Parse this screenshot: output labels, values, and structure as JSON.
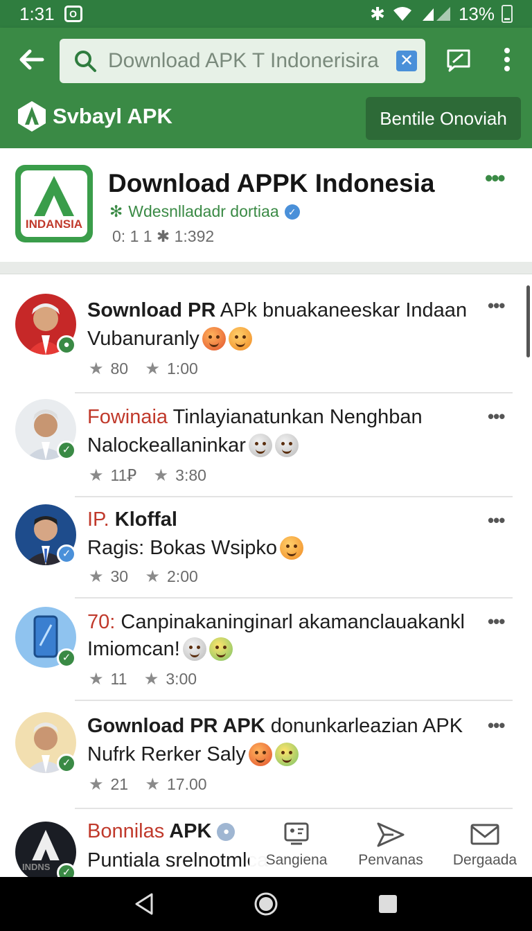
{
  "status_bar": {
    "time": "1:31",
    "battery": "13%",
    "icons": [
      "notification-icon",
      "bluetooth-icon",
      "wifi-icon",
      "signal-icon",
      "battery-icon"
    ]
  },
  "app_bar": {
    "search": {
      "value": "Download APK T Indonerisira",
      "placeholder": "Download APK T Indonerisira"
    },
    "brand_name": "Svbayl APK",
    "action_label": "Bentile Onoviah"
  },
  "app_info": {
    "logo_text": "INDANSIA",
    "title": "Download APPK Indonesia",
    "subtitle": "Wdesnlladadr dortiaa",
    "stats": "0: 1 1  ✱ 1:392"
  },
  "posts": [
    {
      "title_highlight": "",
      "title_bold": "Sownload PR",
      "title_rest": " APk bnuakaneeskar Indaan",
      "line2": "Vubanuranly",
      "emojis": [
        "red",
        "orange"
      ],
      "likes": "80",
      "time": "1:00",
      "badge": "green"
    },
    {
      "title_highlight": "Fowinaia",
      "title_bold": "",
      "title_rest": " Tinlayianatunkan Nenghban",
      "line2": "Nalockeallaninkar",
      "emojis": [
        "grey",
        "grey"
      ],
      "likes": "11Ꝑ",
      "time": "3:80",
      "badge": "green"
    },
    {
      "title_highlight": "IP.",
      "title_bold": " Kloffal",
      "title_rest": "",
      "line2": "Ragis: Bokas Wsipko",
      "emojis": [
        "orange"
      ],
      "likes": "30",
      "time": "2:00",
      "badge": "blue"
    },
    {
      "title_highlight": "70:",
      "title_bold": "",
      "title_rest": " Canpinakaninginarl akamanclauakankl",
      "line2": "Imiomcan!",
      "emojis": [
        "grey",
        "green"
      ],
      "likes": "11",
      "time": "3:00",
      "badge": "green"
    },
    {
      "title_highlight": "",
      "title_bold": "Gownload PR APK",
      "title_rest": " donunkarleazian APK",
      "line2": "Nufrk Rerker Saly",
      "emojis": [
        "red",
        "green"
      ],
      "likes": "21",
      "time": "17.00",
      "badge": "green"
    },
    {
      "title_highlight": "Bonnilas",
      "title_bold": " APK",
      "title_rest": "",
      "line2": "Puntiala srelnotmlca",
      "emojis": [],
      "likes": "",
      "time": "",
      "badge": "green"
    }
  ],
  "bottom_tabs": [
    {
      "label": "Sangiena",
      "icon": "id-card-icon"
    },
    {
      "label": "Penvanas",
      "icon": "send-icon"
    },
    {
      "label": "Dergaada",
      "icon": "mail-icon"
    }
  ],
  "colors": {
    "primary": "#3a8a45",
    "primary_dark": "#2f7d3f",
    "accent_red": "#c0392b",
    "verify_blue": "#4a90d9"
  }
}
